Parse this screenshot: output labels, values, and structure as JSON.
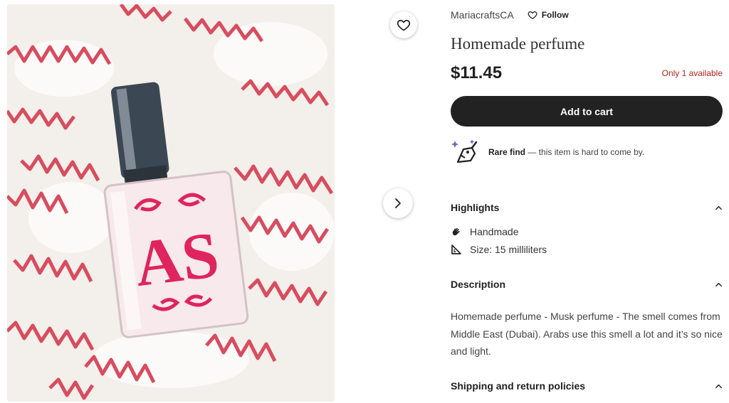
{
  "shop": {
    "name": "MariacraftsCA",
    "follow_label": "Follow"
  },
  "product": {
    "title": "Homemade perfume",
    "price": "$11.45",
    "availability": "Only 1 available",
    "photo_text": "AS"
  },
  "actions": {
    "add_to_cart": "Add to cart"
  },
  "rare": {
    "title": "Rare find",
    "text": " — this item is hard to come by."
  },
  "highlights": {
    "heading": "Highlights",
    "items": [
      {
        "label": "Handmade",
        "icon": "hand-icon"
      },
      {
        "label": "Size: 15 milliliters",
        "icon": "ruler-icon"
      }
    ]
  },
  "description": {
    "heading": "Description",
    "text": "Homemade perfume - Musk perfume - The smell comes from Middle East (Dubai). Arabs use this smell a lot and it’s so nice and light."
  },
  "shipping": {
    "heading": "Shipping and return policies"
  },
  "colors": {
    "cart_button": "#222222",
    "availability": "#b3261e",
    "accent_pink": "#e0245e"
  }
}
